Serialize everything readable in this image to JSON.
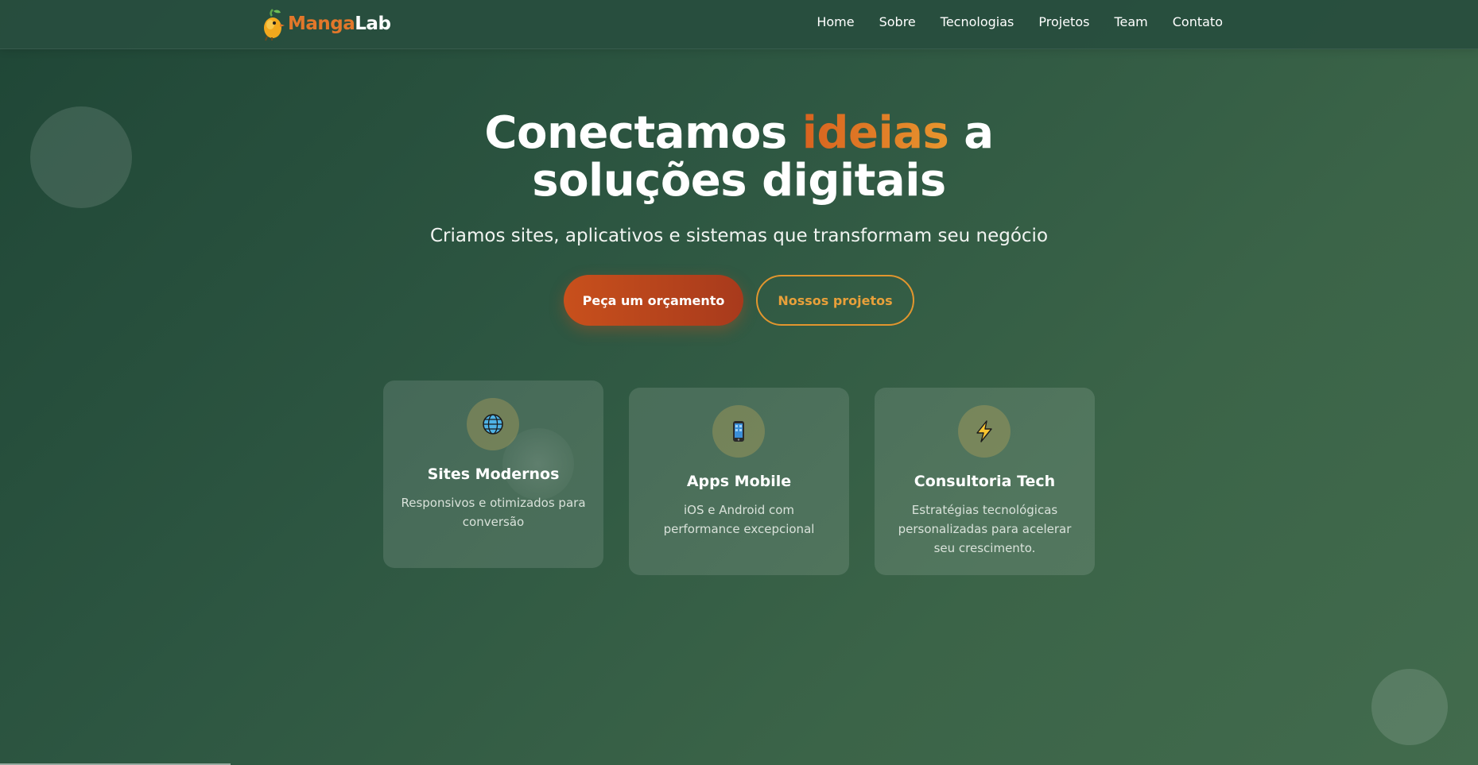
{
  "brand": {
    "name_part1": "Manga",
    "name_part2": "Lab",
    "logo_icon": "mango-bird-icon",
    "accent_color": "#e2772a"
  },
  "nav": {
    "items": [
      "Home",
      "Sobre",
      "Tecnologias",
      "Projetos",
      "Team",
      "Contato"
    ]
  },
  "hero": {
    "title_part1": "Conectamos ",
    "title_accent": "ideias",
    "title_part2": " a",
    "title_line2": "soluções digitais",
    "subtitle": "Criamos sites, aplicativos e sistemas que transformam seu negócio",
    "cta_primary": "Peça um orçamento",
    "cta_secondary": "Nossos projetos"
  },
  "cards": [
    {
      "icon": "globe-icon",
      "title": "Sites Modernos",
      "description": "Responsivos e otimizados para conversão"
    },
    {
      "icon": "mobile-phone-icon",
      "title": "Apps Mobile",
      "description": "iOS e Android com performance excepcional"
    },
    {
      "icon": "lightning-icon",
      "title": "Consultoria Tech",
      "description": "Estratégias tecnológicas personalizadas para acelerar seu crescimento."
    }
  ],
  "colors": {
    "background": "#2e5742",
    "primary_button": "#c8501c",
    "secondary_border": "#e2962e"
  }
}
